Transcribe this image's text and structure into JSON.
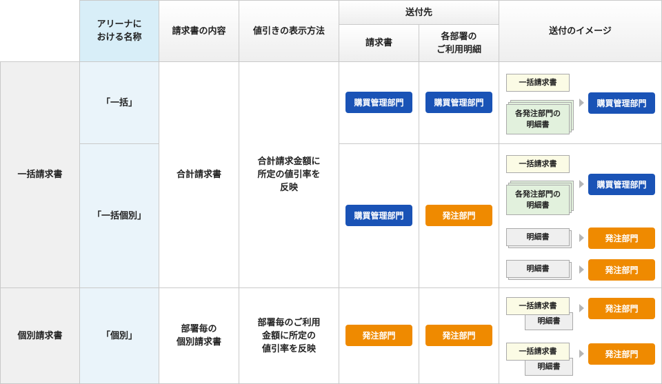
{
  "headers": {
    "arena_name": "アリーナに\nおける名称",
    "invoice_content": "請求書の内容",
    "discount_display": "値引きの表示方法",
    "send_to": "送付先",
    "invoice": "請求書",
    "dept_detail": "各部署の\nご利用明細",
    "send_image": "送付のイメージ"
  },
  "row_labels": {
    "bulk_invoice": "一括請求書",
    "individual_invoice": "個別請求書"
  },
  "arena_names": {
    "ikkatsu": "「一括」",
    "ikkatsu_kobetsu": "「一括個別」",
    "kobetsu": "「個別」"
  },
  "contents": {
    "total_invoice": "合計請求書",
    "dept_individual": "部署毎の\n個別請求書"
  },
  "discounts": {
    "total_rate": "合計請求金額に\n所定の値引率を\n反映",
    "dept_rate": "部署毎のご利用\n金額に所定の\n値引率を反映"
  },
  "departments": {
    "purchasing": "購買管理部門",
    "ordering": "発注部門"
  },
  "documents": {
    "bulk_invoice": "一括請求書",
    "order_dept_details": "各発注部門の\n明細書",
    "details": "明細書"
  },
  "colors": {
    "purchasing_blue": "#1a53b6",
    "ordering_orange": "#ef8a00",
    "header_blue": "#d8eef8",
    "doc_yellow": "#fbfbe5",
    "doc_green": "#e2f1dd"
  }
}
